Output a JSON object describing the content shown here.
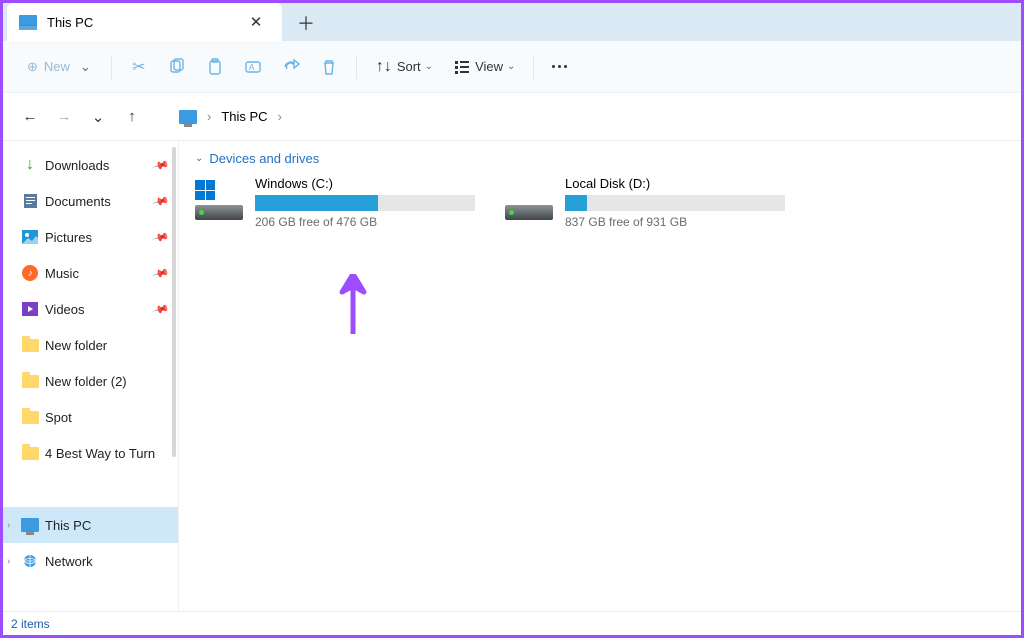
{
  "tab": {
    "title": "This PC"
  },
  "toolbar": {
    "new_label": "New",
    "sort_label": "Sort",
    "view_label": "View"
  },
  "breadcrumb": {
    "root": "This PC"
  },
  "sidebar": {
    "pinned": [
      {
        "label": "Downloads",
        "icon": "download"
      },
      {
        "label": "Documents",
        "icon": "document"
      },
      {
        "label": "Pictures",
        "icon": "picture"
      },
      {
        "label": "Music",
        "icon": "music"
      },
      {
        "label": "Videos",
        "icon": "video"
      }
    ],
    "folders": [
      {
        "label": "New folder"
      },
      {
        "label": "New folder (2)"
      },
      {
        "label": "Spot"
      },
      {
        "label": "4 Best Way to Turn"
      }
    ],
    "tree": [
      {
        "label": "This PC",
        "icon": "pc",
        "selected": true
      },
      {
        "label": "Network",
        "icon": "network",
        "selected": false
      }
    ]
  },
  "section": {
    "title": "Devices and drives"
  },
  "drives": [
    {
      "name": "Windows (C:)",
      "free_text": "206 GB free of 476 GB",
      "used_pct": 56,
      "os_badge": true
    },
    {
      "name": "Local Disk (D:)",
      "free_text": "837 GB free of 931 GB",
      "used_pct": 10,
      "os_badge": false
    }
  ],
  "status": {
    "text": "2 items"
  }
}
